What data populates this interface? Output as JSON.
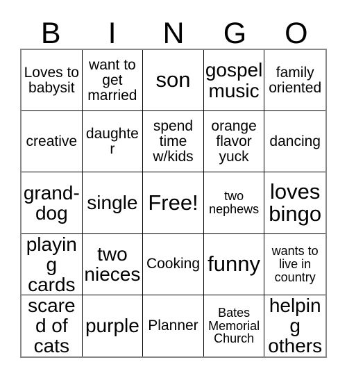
{
  "title": "BINGO card",
  "header": {
    "letters": [
      "B",
      "I",
      "N",
      "G",
      "O"
    ]
  },
  "grid": {
    "rows": 5,
    "columns": 5,
    "border_color": "#000000",
    "outer_border_color": "#888888",
    "background": "#ffffff",
    "text_color": "#000000"
  },
  "cells": [
    {
      "text": "Loves to babysit",
      "size": "sz-md",
      "free": false
    },
    {
      "text": "want to get married",
      "size": "sz-md",
      "free": false
    },
    {
      "text": "son",
      "size": "sz-xl",
      "free": false
    },
    {
      "text": "gospel music",
      "size": "sz-lg",
      "free": false
    },
    {
      "text": "family oriented",
      "size": "sz-md",
      "free": false
    },
    {
      "text": "creative",
      "size": "sz-md",
      "free": false
    },
    {
      "text": "daughter",
      "size": "sz-md",
      "free": false
    },
    {
      "text": "spend time w/kids",
      "size": "sz-md",
      "free": false
    },
    {
      "text": "orange flavor yuck",
      "size": "sz-md",
      "free": false
    },
    {
      "text": "dancing",
      "size": "sz-md",
      "free": false
    },
    {
      "text": "grand-dog",
      "size": "sz-lg",
      "free": false
    },
    {
      "text": "single",
      "size": "sz-lg",
      "free": false
    },
    {
      "text": "Free!",
      "size": "sz-xl",
      "free": true
    },
    {
      "text": "two nephews",
      "size": "sz-sm",
      "free": false
    },
    {
      "text": "loves bingo",
      "size": "sz-xl",
      "free": false
    },
    {
      "text": "playing cards",
      "size": "sz-lg",
      "free": false
    },
    {
      "text": "two nieces",
      "size": "sz-lg",
      "free": false
    },
    {
      "text": "Cooking",
      "size": "sz-md",
      "free": false
    },
    {
      "text": "funny",
      "size": "sz-xl",
      "free": false
    },
    {
      "text": "wants to live in country",
      "size": "sz-sm",
      "free": false
    },
    {
      "text": "scared of cats",
      "size": "sz-lg",
      "free": false
    },
    {
      "text": "purple",
      "size": "sz-lg",
      "free": false
    },
    {
      "text": "Planner",
      "size": "sz-md",
      "free": false
    },
    {
      "text": "Bates Memorial Church",
      "size": "sz-sm",
      "free": false
    },
    {
      "text": "helping others",
      "size": "sz-lg",
      "free": false
    }
  ]
}
